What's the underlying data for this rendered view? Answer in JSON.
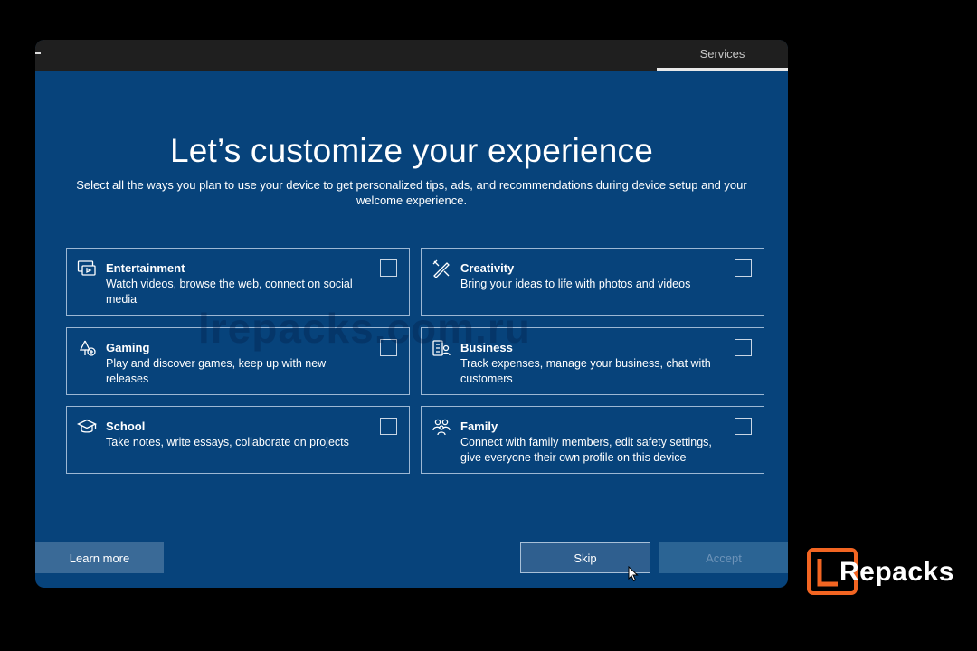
{
  "window": {
    "tab_services": "Services"
  },
  "main": {
    "heading": "Let’s customize your experience",
    "subtitle": "Select all the ways you plan to use your device to get personalized tips, ads, and recommendations during device setup and your welcome experience.",
    "watermark": "lrepacks.com.ru"
  },
  "options": [
    {
      "title": "Entertainment",
      "description": "Watch videos, browse the web, connect on social media",
      "icon": "entertainment-icon",
      "checked": false
    },
    {
      "title": "Creativity",
      "description": "Bring your ideas to life with photos and videos",
      "icon": "creativity-icon",
      "checked": false
    },
    {
      "title": "Gaming",
      "description": "Play and discover games, keep up with new releases",
      "icon": "gaming-icon",
      "checked": false
    },
    {
      "title": "Business",
      "description": "Track expenses, manage your business, chat with customers",
      "icon": "business-icon",
      "checked": false
    },
    {
      "title": "School",
      "description": "Take notes, write essays, collaborate on projects",
      "icon": "school-icon",
      "checked": false
    },
    {
      "title": "Family",
      "description": "Connect with family members, edit safety settings, give everyone their own profile on this device",
      "icon": "family-icon",
      "checked": false
    }
  ],
  "footer": {
    "learn_more": "Learn more",
    "skip": "Skip",
    "accept": "Accept"
  },
  "logo": {
    "text": "Repacks"
  },
  "colors": {
    "background": "#07437b",
    "card_border": "#9db8d4",
    "logo_accent": "#f26522"
  }
}
